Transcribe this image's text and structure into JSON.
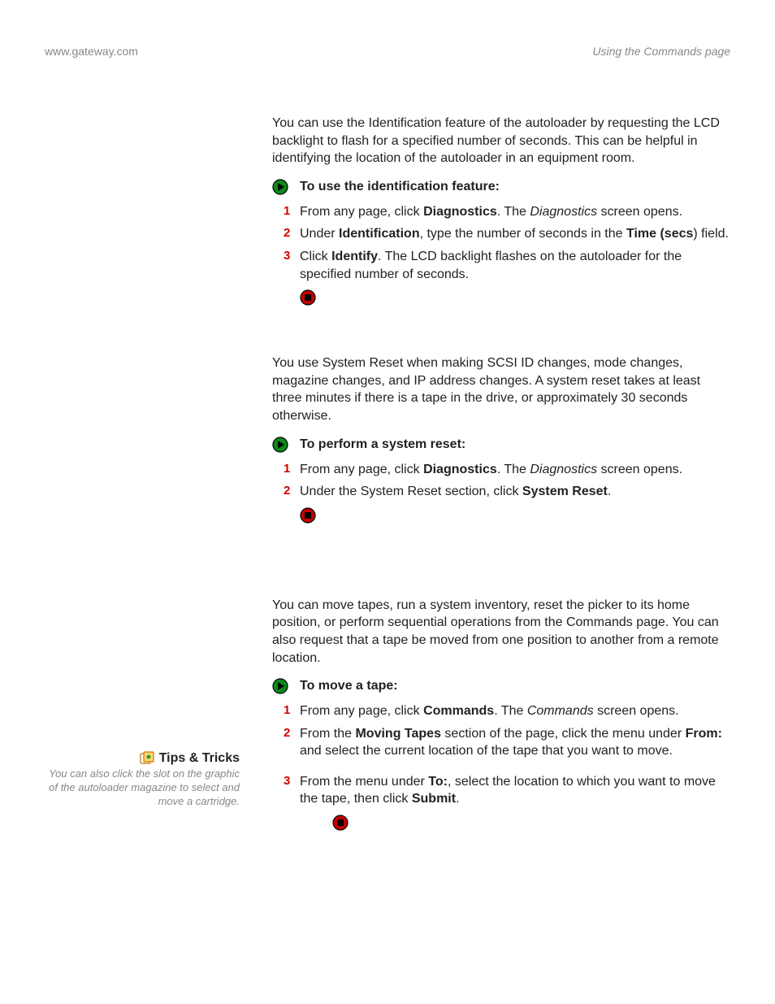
{
  "header": {
    "left": "www.gateway.com",
    "right": "Using the Commands page"
  },
  "identification": {
    "intro": {
      "pre": "You can use the Identification feature of the autoloader by requesting the LCD backlight to flash for a specified number of seconds. This can be helpful in identifying the location of the autoloader in an equipment room."
    },
    "heading": "To use the identification feature:",
    "steps": {
      "s1": {
        "num": "1",
        "p1": "From any page, click ",
        "b1": "Diagnostics",
        "p2": ". The ",
        "i1": "Diagnostics",
        "p3": " screen opens."
      },
      "s2": {
        "num": "2",
        "p1": "Under ",
        "b1": "Identification",
        "p2": ", type the number of seconds in the ",
        "b2": "Time (secs",
        "p3": ") field."
      },
      "s3": {
        "num": "3",
        "p1": "Click ",
        "b1": "Identify",
        "p2": ". The LCD backlight flashes on the autoloader for the specified number of seconds."
      }
    }
  },
  "systemreset": {
    "intro": {
      "pre": "You use System Reset when making SCSI ID changes, mode changes, magazine changes, and IP address changes. A system reset takes at least three minutes if there is a tape in the drive, or approximately 30 seconds otherwise."
    },
    "heading": "To perform a system reset:",
    "steps": {
      "s1": {
        "num": "1",
        "p1": "From any page, click ",
        "b1": "Diagnostics",
        "p2": ". The ",
        "i1": "Diagnostics",
        "p3": " screen opens."
      },
      "s2": {
        "num": "2",
        "p1": "Under the System Reset section, click ",
        "b1": "System Reset",
        "p2": "."
      }
    }
  },
  "commands": {
    "intro": {
      "pre": "You can move tapes, run a system inventory, reset the picker to its home position, or perform sequential operations from the Commands page. You can also request that a tape be moved from one position to another from a remote location."
    },
    "heading": "To move a tape:",
    "steps": {
      "s1": {
        "num": "1",
        "p1": "From any page, click ",
        "b1": "Commands",
        "p2": ". The ",
        "i1": "Commands",
        "p3": " screen opens."
      },
      "s2": {
        "num": "2",
        "p1": "From the ",
        "b1": "Moving Tapes",
        "p2": " section of the page, click the menu under ",
        "b2": "From:",
        "p3": " and select the current location of the tape that you want to move."
      },
      "s3": {
        "num": "3",
        "p1": "From the menu under ",
        "b1": "To:",
        "p2": ", select the location to which you want to move the tape, then click ",
        "b2": "Submit",
        "p3": "."
      }
    },
    "tips": {
      "title": "Tips & Tricks",
      "body": "You can also click the slot on the graphic of the autoloader magazine to select and move a cartridge."
    }
  }
}
